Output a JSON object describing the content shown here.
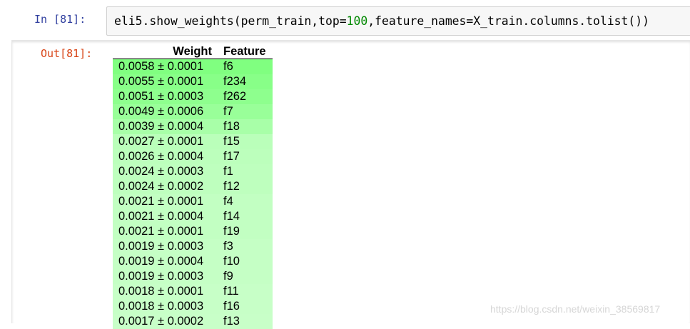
{
  "cell": {
    "in_prompt": "In  [81]:",
    "out_prompt": "Out[81]:",
    "code": {
      "prefix": "eli5.show_weights(perm_train,top=",
      "number": "100",
      "suffix": ",feature_names=X_train.columns.tolist())"
    }
  },
  "table": {
    "headers": {
      "weight": "Weight",
      "feature": "Feature"
    },
    "rows": [
      {
        "weight": "0.0058 ± 0.0001",
        "feature": "f6",
        "color": "#80ff80"
      },
      {
        "weight": "0.0055 ± 0.0001",
        "feature": "f234",
        "color": "#88ff88"
      },
      {
        "weight": "0.0051 ± 0.0003",
        "feature": "f262",
        "color": "#8eff8e"
      },
      {
        "weight": "0.0049 ± 0.0006",
        "feature": "f7",
        "color": "#99ff99"
      },
      {
        "weight": "0.0039 ± 0.0004",
        "feature": "f18",
        "color": "#a8ffa8"
      },
      {
        "weight": "0.0027 ± 0.0001",
        "feature": "f15",
        "color": "#baffba"
      },
      {
        "weight": "0.0026 ± 0.0004",
        "feature": "f17",
        "color": "#bcffbc"
      },
      {
        "weight": "0.0024 ± 0.0003",
        "feature": "f1",
        "color": "#beffbe"
      },
      {
        "weight": "0.0024 ± 0.0002",
        "feature": "f12",
        "color": "#beffbe"
      },
      {
        "weight": "0.0021 ± 0.0001",
        "feature": "f4",
        "color": "#c2ffc2"
      },
      {
        "weight": "0.0021 ± 0.0004",
        "feature": "f14",
        "color": "#c2ffc2"
      },
      {
        "weight": "0.0021 ± 0.0001",
        "feature": "f19",
        "color": "#c2ffc2"
      },
      {
        "weight": "0.0019 ± 0.0003",
        "feature": "f3",
        "color": "#c5ffc5"
      },
      {
        "weight": "0.0019 ± 0.0004",
        "feature": "f10",
        "color": "#c5ffc5"
      },
      {
        "weight": "0.0019 ± 0.0003",
        "feature": "f9",
        "color": "#c5ffc5"
      },
      {
        "weight": "0.0018 ± 0.0001",
        "feature": "f11",
        "color": "#c7ffc7"
      },
      {
        "weight": "0.0018 ± 0.0003",
        "feature": "f16",
        "color": "#c7ffc7"
      },
      {
        "weight": "0.0017 ± 0.0002",
        "feature": "f13",
        "color": "#c8ffc8"
      }
    ]
  },
  "watermark": "https://blog.csdn.net/weixin_38569817"
}
